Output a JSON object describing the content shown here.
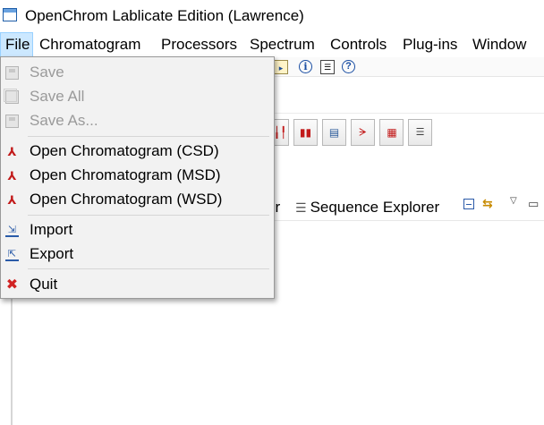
{
  "window": {
    "title": "OpenChrom Lablicate Edition (Lawrence)"
  },
  "menubar": {
    "items": [
      {
        "label": "File",
        "active": true
      },
      {
        "label": "Chromatogram"
      },
      {
        "label": "Processors"
      },
      {
        "label": "Spectrum"
      },
      {
        "label": "Controls"
      },
      {
        "label": "Plug-ins"
      },
      {
        "label": "Window"
      }
    ]
  },
  "toolbar": {
    "icons": [
      "import-chromatogram-icon",
      "info-icon",
      "list-view-icon",
      "help-icon"
    ],
    "glyphs": {
      "info": "i",
      "list": "☰",
      "help": "?"
    }
  },
  "tool_buttons": {
    "icons": [
      "chromatogram-peaks-icon",
      "spectrum-bars-icon",
      "bar-stack-icon",
      "peak-detect-icon",
      "grid-heatmap-icon",
      "list-settings-icon"
    ],
    "glyphs": [
      "╽╽╿",
      "▮▮",
      "▤",
      "ᗒ",
      "▦",
      "☰"
    ]
  },
  "views": {
    "partial_tab_label": "er",
    "tab_label": "Sequence Explorer",
    "tab_icon_glyph": "☰"
  },
  "file_menu": {
    "items": [
      {
        "label": "Save",
        "icon": "save-icon",
        "glyph": "",
        "enabled": false
      },
      {
        "label": "Save All",
        "icon": "save-all-icon",
        "glyph": "",
        "enabled": false
      },
      {
        "label": "Save As...",
        "icon": "save-as-icon",
        "glyph": "",
        "enabled": false
      },
      {
        "label": "Open Chromatogram (CSD)",
        "icon": "chromatogram-icon",
        "glyph": "⅄",
        "enabled": true
      },
      {
        "label": "Open Chromatogram (MSD)",
        "icon": "chromatogram-icon",
        "glyph": "⅄",
        "enabled": true
      },
      {
        "label": "Open Chromatogram (WSD)",
        "icon": "chromatogram-icon",
        "glyph": "⅄",
        "enabled": true
      },
      {
        "label": "Import",
        "icon": "import-icon",
        "glyph": "⇲",
        "enabled": true
      },
      {
        "label": "Export",
        "icon": "export-icon",
        "glyph": "⇱",
        "enabled": true
      },
      {
        "label": "Quit",
        "icon": "quit-icon",
        "glyph": "✖",
        "enabled": true
      }
    ]
  },
  "colors": {
    "menu_highlight": "#cce8ff",
    "menu_highlight_border": "#99d1ff",
    "disabled_text": "#9a9a9a",
    "chromatogram_red": "#c21a1a",
    "import_blue": "#2a5ba8"
  }
}
